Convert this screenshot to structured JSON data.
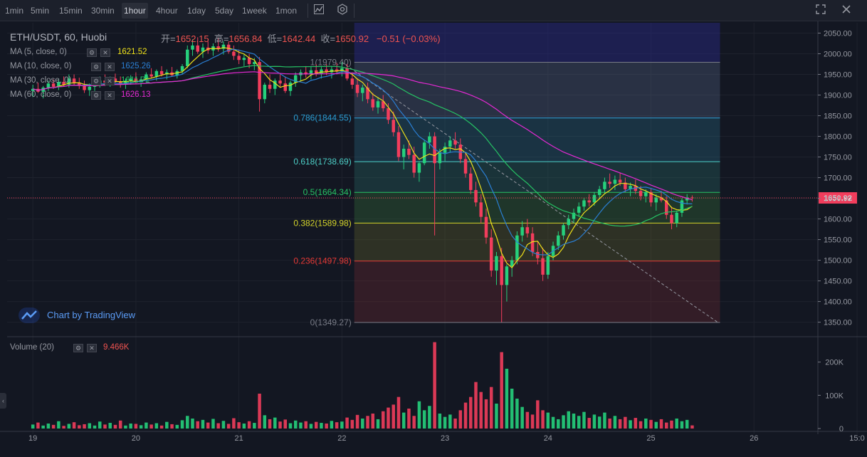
{
  "toolbar": {
    "timeframes": [
      "1min",
      "5min",
      "15min",
      "30min",
      "1hour",
      "4hour",
      "1day",
      "5day",
      "1week",
      "1mon"
    ],
    "active_timeframe": "1hour",
    "icons": [
      "candle-chart-icon",
      "settings-icon",
      "fullscreen-icon",
      "close-icon"
    ]
  },
  "legend": {
    "symbol": "ETH/USDT, 60, Huobi",
    "open_label": "开=",
    "open": "1652.15",
    "high_label": "高=",
    "high": "1656.84",
    "low_label": "低=",
    "low": "1642.44",
    "close_label": "收=",
    "close": "1650.92",
    "change": "−0.51 (−0.03%)",
    "ma": [
      {
        "label": "MA (5, close, 0)",
        "value": "1621.52",
        "color": "#f0e21a"
      },
      {
        "label": "MA (10, close, 0)",
        "value": "1625.26",
        "color": "#2a7fd4"
      },
      {
        "label": "MA (30, close, 0)",
        "value": "1611.71",
        "color": "#26c264"
      },
      {
        "label": "MA (60, close, 0)",
        "value": "1626.13",
        "color": "#e629d4"
      }
    ],
    "volume_label": "Volume (20)",
    "volume_value": "9.466K"
  },
  "branding": {
    "text": "Chart by TradingView"
  },
  "chart_data": {
    "type": "candlestick",
    "title": "ETH/USDT, 60, Huobi",
    "price_axis": {
      "ticks": [
        1350,
        1400,
        1450,
        1500,
        1550,
        1600,
        1650,
        1700,
        1750,
        1800,
        1850,
        1900,
        1950,
        2000,
        2050
      ],
      "labels": [
        "1350.00",
        "1400.00",
        "1450.00",
        "1500.00",
        "1550.00",
        "1600.00",
        "1650.00",
        "1700.00",
        "1750.00",
        "1800.00",
        "1850.00",
        "1900.00",
        "1950.00",
        "2000.00",
        "2050.00"
      ],
      "range": [
        1320,
        2075
      ]
    },
    "volume_axis": {
      "ticks": [
        0,
        100000,
        200000
      ],
      "labels": [
        "0",
        "100K",
        "200K"
      ],
      "range": [
        0,
        270000
      ]
    },
    "time_axis": {
      "labels": [
        "19",
        "20",
        "21",
        "22",
        "23",
        "24",
        "25",
        "26",
        "15:0"
      ]
    },
    "last_price": "1650.92",
    "fib_levels": [
      {
        "label": "1(1979.40)",
        "price": 1979.4,
        "color": "#787b86",
        "fill": "#787b86"
      },
      {
        "label": "0.786(1844.55)",
        "price": 1844.55,
        "color": "#2a9ed4",
        "fill": "#5b6b8c"
      },
      {
        "label": "0.618(1738.69)",
        "price": 1738.69,
        "color": "#4dd0c8",
        "fill": "#2a6f8a"
      },
      {
        "label": "0.5(1664.34)",
        "price": 1664.34,
        "color": "#26c264",
        "fill": "#2a6f6a"
      },
      {
        "label": "0.382(1589.98)",
        "price": 1589.98,
        "color": "#d4d42a",
        "fill": "#3a7a3a"
      },
      {
        "label": "0.236(1497.98)",
        "price": 1497.98,
        "color": "#e53935",
        "fill": "#6a6a2a"
      },
      {
        "label": "0(1349.27)",
        "price": 1349.27,
        "color": "#787b86",
        "fill": "#7a2a33"
      }
    ],
    "fib_top_band": {
      "from": 1979.4,
      "to": 2075,
      "fill": "#2a2a8a"
    },
    "trend_line": [
      {
        "t": 22.0,
        "price": 1979.4
      },
      {
        "t": 25.65,
        "price": 1349.27
      }
    ],
    "candles_ohlc": [
      [
        19.0,
        1910,
        1925,
        1895,
        1915
      ],
      [
        19.05,
        1915,
        1930,
        1905,
        1908
      ],
      [
        19.1,
        1908,
        1922,
        1892,
        1918
      ],
      [
        19.15,
        1918,
        1935,
        1910,
        1928
      ],
      [
        19.2,
        1928,
        1938,
        1915,
        1920
      ],
      [
        19.25,
        1920,
        1940,
        1912,
        1932
      ],
      [
        19.3,
        1932,
        1945,
        1920,
        1925
      ],
      [
        19.35,
        1925,
        1950,
        1918,
        1940
      ],
      [
        19.4,
        1940,
        1950,
        1925,
        1930
      ],
      [
        19.45,
        1930,
        1942,
        1915,
        1922
      ],
      [
        19.5,
        1922,
        1935,
        1905,
        1912
      ],
      [
        19.55,
        1912,
        1928,
        1898,
        1920
      ],
      [
        19.6,
        1920,
        1935,
        1910,
        1928
      ],
      [
        19.65,
        1928,
        1945,
        1918,
        1935
      ],
      [
        19.7,
        1935,
        1950,
        1922,
        1930
      ],
      [
        19.75,
        1930,
        1945,
        1920,
        1940
      ],
      [
        19.8,
        1940,
        1952,
        1928,
        1932
      ],
      [
        19.85,
        1932,
        1945,
        1918,
        1925
      ],
      [
        19.9,
        1925,
        1940,
        1915,
        1935
      ],
      [
        19.95,
        1935,
        1948,
        1925,
        1940
      ],
      [
        20.0,
        1940,
        1955,
        1928,
        1932
      ],
      [
        20.05,
        1932,
        1945,
        1920,
        1938
      ],
      [
        20.1,
        1938,
        1955,
        1930,
        1950
      ],
      [
        20.15,
        1950,
        1965,
        1940,
        1945
      ],
      [
        20.2,
        1945,
        1962,
        1935,
        1958
      ],
      [
        20.25,
        1958,
        1970,
        1945,
        1950
      ],
      [
        20.3,
        1950,
        1962,
        1938,
        1955
      ],
      [
        20.35,
        1955,
        1968,
        1945,
        1948
      ],
      [
        20.4,
        1948,
        1962,
        1940,
        1958
      ],
      [
        20.45,
        1958,
        1975,
        1950,
        1970
      ],
      [
        20.5,
        1970,
        2020,
        1965,
        2010
      ],
      [
        20.55,
        2010,
        2035,
        1995,
        2020
      ],
      [
        20.6,
        2020,
        2040,
        2000,
        2005
      ],
      [
        20.65,
        2005,
        2025,
        1990,
        2015
      ],
      [
        20.7,
        2015,
        2030,
        2000,
        2008
      ],
      [
        20.75,
        2008,
        2025,
        1995,
        2018
      ],
      [
        20.8,
        2018,
        2038,
        2005,
        2012
      ],
      [
        20.85,
        2012,
        2030,
        1998,
        2022
      ],
      [
        20.9,
        2022,
        2030,
        2000,
        2005
      ],
      [
        20.95,
        2005,
        2020,
        1985,
        1995
      ],
      [
        21.0,
        1995,
        2010,
        1975,
        1985
      ],
      [
        21.05,
        1985,
        2000,
        1970,
        1990
      ],
      [
        21.1,
        1990,
        2000,
        1965,
        1975
      ],
      [
        21.15,
        1975,
        1990,
        1960,
        1980
      ],
      [
        21.2,
        1980,
        1992,
        1860,
        1890
      ],
      [
        21.25,
        1890,
        1930,
        1880,
        1925
      ],
      [
        21.3,
        1925,
        1950,
        1905,
        1915
      ],
      [
        21.35,
        1915,
        1940,
        1900,
        1935
      ],
      [
        21.4,
        1935,
        1950,
        1920,
        1928
      ],
      [
        21.45,
        1928,
        1945,
        1905,
        1910
      ],
      [
        21.5,
        1910,
        1935,
        1898,
        1930
      ],
      [
        21.55,
        1930,
        1955,
        1920,
        1948
      ],
      [
        21.6,
        1948,
        1962,
        1935,
        1955
      ],
      [
        21.65,
        1955,
        1970,
        1942,
        1950
      ],
      [
        21.7,
        1950,
        1968,
        1938,
        1960
      ],
      [
        21.75,
        1960,
        1975,
        1945,
        1952
      ],
      [
        21.8,
        1952,
        1968,
        1940,
        1962
      ],
      [
        21.85,
        1962,
        1975,
        1948,
        1955
      ],
      [
        21.9,
        1955,
        1970,
        1940,
        1962
      ],
      [
        21.95,
        1962,
        1978,
        1950,
        1958
      ],
      [
        22.0,
        1958,
        1980,
        1945,
        1965
      ],
      [
        22.05,
        1965,
        1975,
        1935,
        1940
      ],
      [
        22.1,
        1940,
        1955,
        1915,
        1925
      ],
      [
        22.15,
        1925,
        1940,
        1895,
        1905
      ],
      [
        22.2,
        1905,
        1925,
        1885,
        1918
      ],
      [
        22.25,
        1918,
        1930,
        1880,
        1890
      ],
      [
        22.3,
        1890,
        1905,
        1862,
        1870
      ],
      [
        22.35,
        1870,
        1895,
        1855,
        1885
      ],
      [
        22.4,
        1885,
        1900,
        1860,
        1868
      ],
      [
        22.45,
        1868,
        1880,
        1830,
        1840
      ],
      [
        22.5,
        1840,
        1860,
        1800,
        1810
      ],
      [
        22.55,
        1810,
        1825,
        1740,
        1750
      ],
      [
        22.6,
        1750,
        1780,
        1720,
        1770
      ],
      [
        22.65,
        1770,
        1790,
        1745,
        1755
      ],
      [
        22.7,
        1755,
        1775,
        1700,
        1712
      ],
      [
        22.75,
        1712,
        1740,
        1690,
        1735
      ],
      [
        22.8,
        1735,
        1790,
        1730,
        1785
      ],
      [
        22.85,
        1785,
        1810,
        1770,
        1800
      ],
      [
        22.9,
        1800,
        1810,
        1560,
        1735
      ],
      [
        22.95,
        1735,
        1770,
        1720,
        1760
      ],
      [
        23.0,
        1760,
        1785,
        1740,
        1775
      ],
      [
        23.05,
        1775,
        1800,
        1760,
        1790
      ],
      [
        23.1,
        1790,
        1810,
        1770,
        1780
      ],
      [
        23.15,
        1780,
        1795,
        1735,
        1745
      ],
      [
        23.2,
        1745,
        1760,
        1700,
        1710
      ],
      [
        23.25,
        1710,
        1725,
        1660,
        1670
      ],
      [
        23.3,
        1670,
        1690,
        1630,
        1640
      ],
      [
        23.35,
        1640,
        1660,
        1590,
        1605
      ],
      [
        23.4,
        1605,
        1625,
        1540,
        1555
      ],
      [
        23.45,
        1555,
        1575,
        1460,
        1475
      ],
      [
        23.5,
        1475,
        1520,
        1440,
        1510
      ],
      [
        23.55,
        1510,
        1530,
        1350,
        1440
      ],
      [
        23.6,
        1440,
        1490,
        1400,
        1485
      ],
      [
        23.65,
        1485,
        1510,
        1460,
        1500
      ],
      [
        23.7,
        1500,
        1570,
        1490,
        1560
      ],
      [
        23.75,
        1560,
        1595,
        1545,
        1580
      ],
      [
        23.8,
        1580,
        1600,
        1555,
        1565
      ],
      [
        23.85,
        1565,
        1580,
        1510,
        1520
      ],
      [
        23.9,
        1520,
        1545,
        1490,
        1505
      ],
      [
        23.95,
        1505,
        1530,
        1450,
        1465
      ],
      [
        24.0,
        1465,
        1520,
        1455,
        1510
      ],
      [
        24.05,
        1510,
        1545,
        1500,
        1535
      ],
      [
        24.1,
        1535,
        1570,
        1525,
        1560
      ],
      [
        24.15,
        1560,
        1590,
        1550,
        1585
      ],
      [
        24.2,
        1585,
        1610,
        1575,
        1600
      ],
      [
        24.25,
        1600,
        1625,
        1590,
        1615
      ],
      [
        24.3,
        1615,
        1640,
        1605,
        1630
      ],
      [
        24.35,
        1630,
        1650,
        1620,
        1645
      ],
      [
        24.4,
        1645,
        1660,
        1630,
        1640
      ],
      [
        24.45,
        1640,
        1665,
        1632,
        1658
      ],
      [
        24.5,
        1658,
        1680,
        1648,
        1672
      ],
      [
        24.55,
        1672,
        1700,
        1662,
        1690
      ],
      [
        24.6,
        1690,
        1710,
        1675,
        1685
      ],
      [
        24.65,
        1685,
        1705,
        1670,
        1695
      ],
      [
        24.7,
        1695,
        1712,
        1680,
        1688
      ],
      [
        24.75,
        1688,
        1700,
        1665,
        1672
      ],
      [
        24.8,
        1672,
        1688,
        1655,
        1680
      ],
      [
        24.85,
        1680,
        1695,
        1660,
        1668
      ],
      [
        24.9,
        1668,
        1680,
        1645,
        1655
      ],
      [
        24.95,
        1655,
        1672,
        1640,
        1665
      ],
      [
        25.0,
        1665,
        1675,
        1630,
        1640
      ],
      [
        25.05,
        1640,
        1660,
        1620,
        1652
      ],
      [
        25.1,
        1652,
        1668,
        1640,
        1645
      ],
      [
        25.15,
        1645,
        1655,
        1600,
        1610
      ],
      [
        25.2,
        1610,
        1630,
        1575,
        1590
      ],
      [
        25.25,
        1590,
        1620,
        1580,
        1615
      ],
      [
        25.3,
        1615,
        1650,
        1605,
        1645
      ],
      [
        25.35,
        1645,
        1660,
        1635,
        1652
      ],
      [
        25.4,
        1652,
        1657,
        1642,
        1651
      ]
    ],
    "volumes": [
      12000,
      18000,
      9000,
      15000,
      11000,
      22000,
      8000,
      14000,
      19000,
      10000,
      13000,
      16000,
      9000,
      21000,
      12000,
      17000,
      11000,
      24000,
      9000,
      15000,
      14000,
      10000,
      18000,
      12000,
      16000,
      9000,
      20000,
      13000,
      11000,
      25000,
      38000,
      30000,
      22000,
      26000,
      18000,
      29000,
      16000,
      23000,
      14000,
      31000,
      19000,
      15000,
      22000,
      17000,
      105000,
      40000,
      28000,
      33000,
      21000,
      27000,
      16000,
      24000,
      18000,
      22000,
      14000,
      20000,
      17000,
      15000,
      23000,
      19000,
      21000,
      33000,
      26000,
      41000,
      30000,
      38000,
      45000,
      28000,
      52000,
      63000,
      72000,
      95000,
      48000,
      60000,
      38000,
      82000,
      55000,
      68000,
      260000,
      45000,
      35000,
      42000,
      30000,
      55000,
      78000,
      95000,
      140000,
      110000,
      88000,
      125000,
      75000,
      230000,
      180000,
      120000,
      90000,
      65000,
      50000,
      42000,
      85000,
      55000,
      48000,
      35000,
      28000,
      40000,
      52000,
      45000,
      38000,
      50000,
      32000,
      42000,
      36000,
      48000,
      30000,
      38000,
      28000,
      35000,
      25000,
      32000,
      22000,
      30000,
      26000,
      20000,
      28000,
      18000,
      24000,
      30000,
      22000,
      26000,
      9466
    ]
  }
}
